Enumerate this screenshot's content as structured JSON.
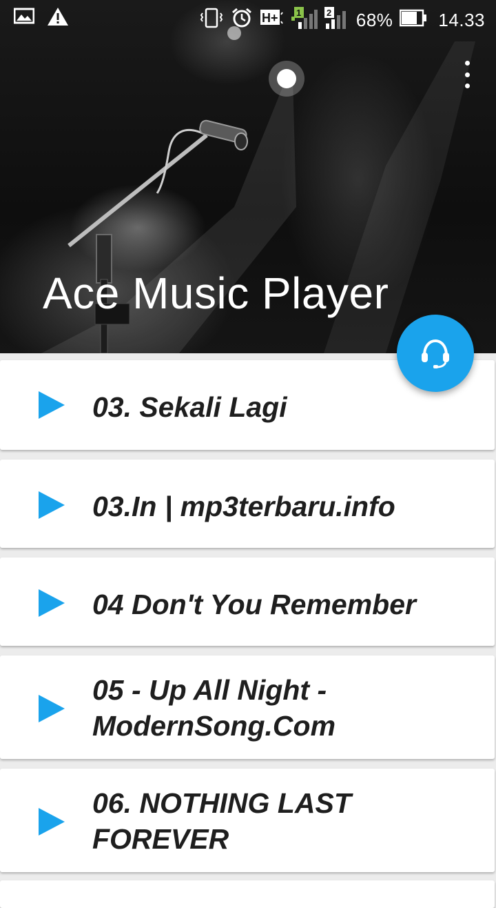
{
  "status_bar": {
    "battery_percent": "68%",
    "time": "14.33",
    "icons": [
      "gallery-icon",
      "warning-icon",
      "vibrate-icon",
      "alarm-icon",
      "hplus-signal-icon",
      "sim1-signal-icon",
      "sim2-signal-icon",
      "battery-icon"
    ],
    "sim1_label": "1",
    "sim2_label": "2",
    "network_label": "H+"
  },
  "header": {
    "app_title": "Ace Music Player",
    "menu_icon": "overflow-menu-icon"
  },
  "fab": {
    "icon": "headset-icon",
    "color": "#1aa3ec"
  },
  "accent_color": "#1aa3ec",
  "songs": [
    {
      "title": "03. Sekali Lagi"
    },
    {
      "title": "03.In | mp3terbaru.info"
    },
    {
      "title": "04 Don't You Remember"
    },
    {
      "title": "05 - Up All Night - ModernSong.Com"
    },
    {
      "title": "06. NOTHING LAST FOREVER"
    }
  ]
}
